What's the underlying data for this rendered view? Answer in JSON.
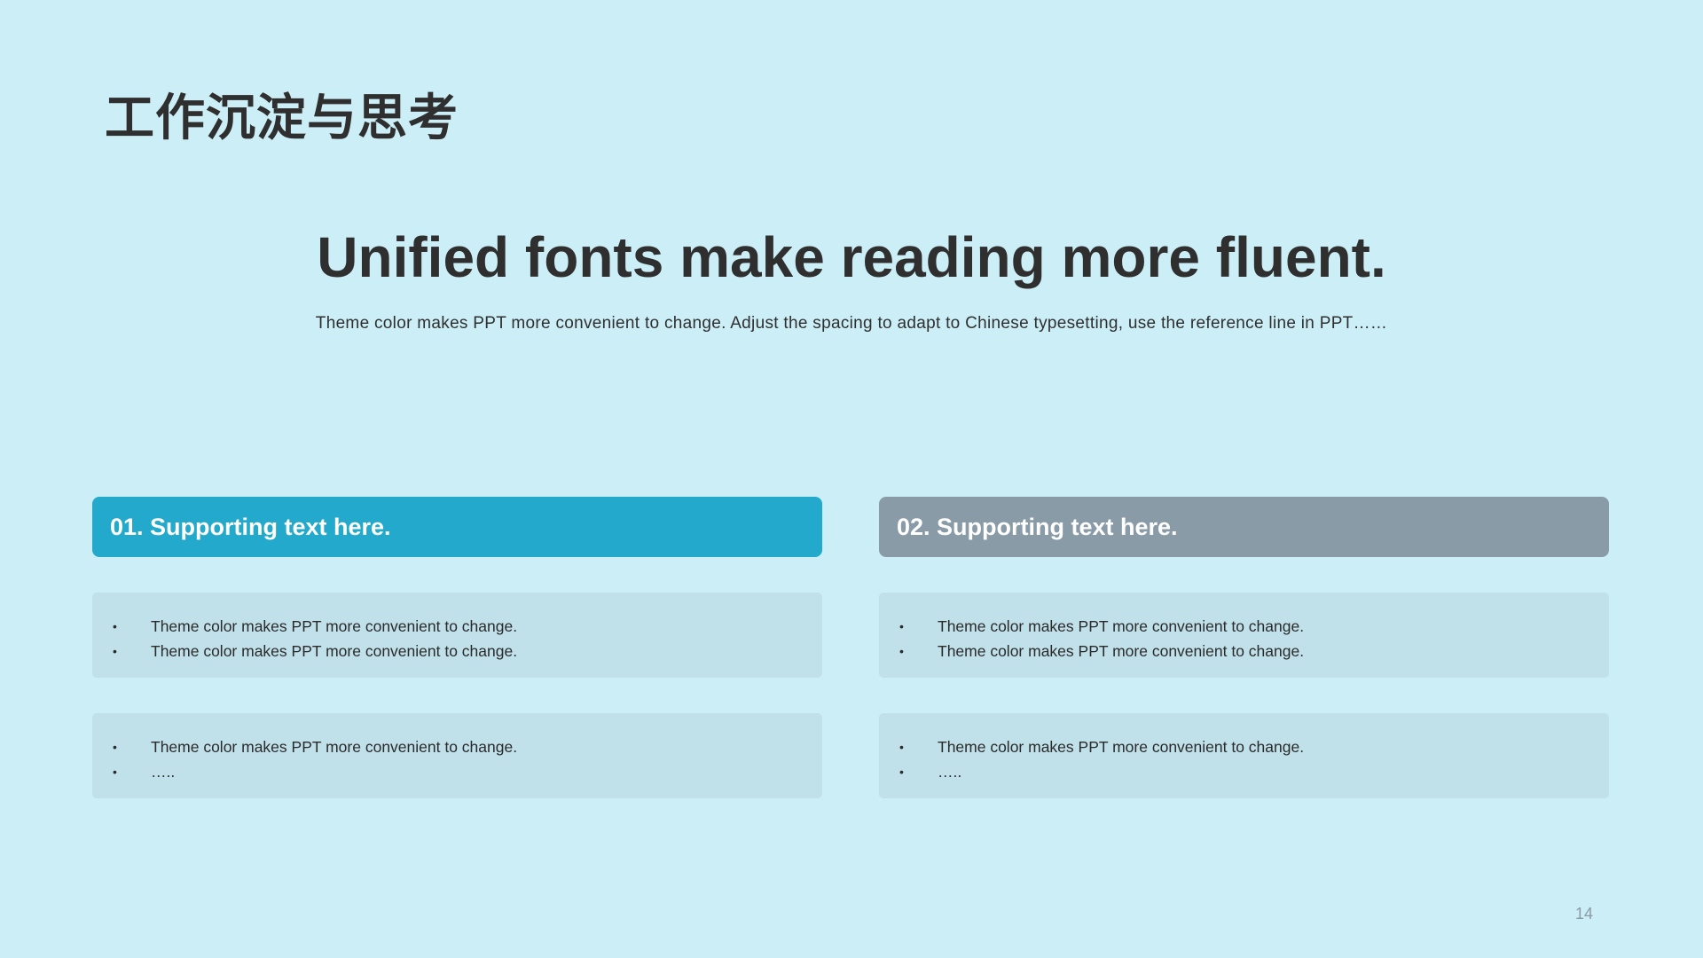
{
  "slide": {
    "title": "工作沉淀与思考",
    "headline": "Unified fonts make reading more fluent.",
    "subline": "Theme color makes PPT more convenient to change. Adjust the spacing to adapt to Chinese typesetting, use the reference line in PPT……",
    "page_number": "14"
  },
  "columns": [
    {
      "header": "01. Supporting text here.",
      "header_color": "#22A9CB",
      "cards": [
        {
          "items": [
            "Theme color makes PPT more convenient to change.",
            "Theme color makes PPT more convenient to change."
          ]
        },
        {
          "items": [
            "Theme color makes PPT more convenient to change.",
            "….."
          ]
        }
      ]
    },
    {
      "header": "02. Supporting text here.",
      "header_color": "#8A9BA8",
      "cards": [
        {
          "items": [
            "Theme color makes PPT more convenient to change.",
            "Theme color makes PPT more convenient to change."
          ]
        },
        {
          "items": [
            "Theme color makes PPT more convenient to change.",
            "….."
          ]
        }
      ]
    }
  ],
  "colors": {
    "background": "#CCEFF7",
    "card": "#C0E0EA",
    "text": "#2F2F2F"
  },
  "icons": {
    "bullet": "bullet-dot-icon"
  }
}
